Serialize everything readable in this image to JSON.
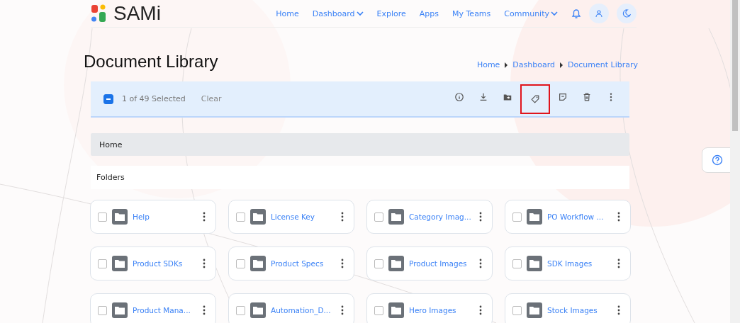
{
  "header": {
    "logo": "SAMi",
    "nav": [
      {
        "label": "Home",
        "dropdown": false
      },
      {
        "label": "Dashboard",
        "dropdown": true
      },
      {
        "label": "Explore",
        "dropdown": false
      },
      {
        "label": "Apps",
        "dropdown": false
      },
      {
        "label": "My Teams",
        "dropdown": false
      },
      {
        "label": "Community",
        "dropdown": true
      }
    ]
  },
  "title": "Document Library",
  "breadcrumb": [
    "Home",
    "Dashboard",
    "Document Library"
  ],
  "selection_bar": {
    "checked": true,
    "count": "1 of 49 Selected",
    "clear": "Clear",
    "actions": [
      {
        "kind": "info",
        "highlighted": false
      },
      {
        "kind": "download",
        "highlighted": false
      },
      {
        "kind": "move",
        "highlighted": false
      },
      {
        "kind": "tag",
        "highlighted": true
      },
      {
        "kind": "note",
        "highlighted": false
      },
      {
        "kind": "delete",
        "highlighted": false
      },
      {
        "kind": "more",
        "highlighted": false
      }
    ]
  },
  "path": "Home",
  "section": "Folders",
  "folders": [
    {
      "name": "Help",
      "checked": false
    },
    {
      "name": "License Key",
      "checked": false
    },
    {
      "name": "Category Imag...",
      "checked": false
    },
    {
      "name": "PO Workflow ...",
      "checked": false
    },
    {
      "name": "Product SDKs",
      "checked": false
    },
    {
      "name": "Product Specs",
      "checked": false
    },
    {
      "name": "Product Images",
      "checked": false
    },
    {
      "name": "SDK Images",
      "checked": false
    },
    {
      "name": "Product Mana...",
      "checked": false
    },
    {
      "name": "Automation_D...",
      "checked": false
    },
    {
      "name": "Hero Images",
      "checked": false
    },
    {
      "name": "Stock Images",
      "checked": false
    }
  ]
}
